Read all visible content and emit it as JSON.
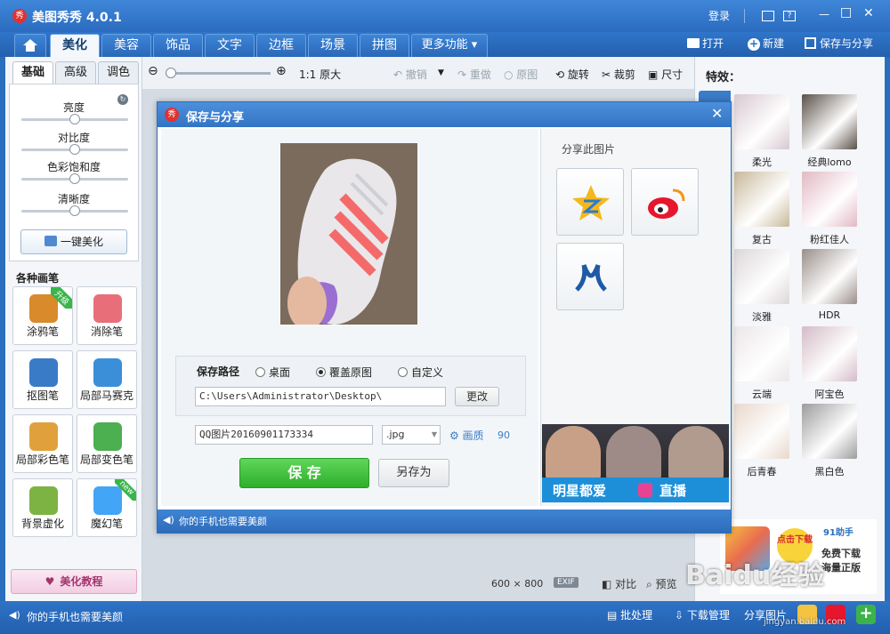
{
  "app": {
    "title": "美图秀秀 4.0.1",
    "logo_glyph": "秀"
  },
  "window_controls": {
    "login": "登录",
    "help": "?",
    "minimize": "—",
    "maximize": "□",
    "close": "✕"
  },
  "menu_tabs": [
    "美化",
    "美容",
    "饰品",
    "文字",
    "边框",
    "场景",
    "拼图",
    "更多功能 ▾"
  ],
  "menu_actions": {
    "open": "打开",
    "new": "新建",
    "save_share": "保存与分享"
  },
  "toolbar": {
    "original_size": "1:1 原大",
    "undo": "撤销",
    "redo": "重做",
    "original": "原图",
    "rotate": "旋转",
    "crop": "裁剪",
    "resize": "尺寸"
  },
  "left_panel": {
    "tabs": [
      "基础",
      "高级",
      "调色"
    ],
    "sliders": [
      {
        "label": "亮度",
        "value": 0.5
      },
      {
        "label": "对比度",
        "value": 0.5
      },
      {
        "label": "色彩饱和度",
        "value": 0.5
      },
      {
        "label": "清晰度",
        "value": 0.5
      }
    ],
    "one_click": "一键美化",
    "brushes_title": "各种画笔",
    "brushes": [
      {
        "label": "涂鸦笔",
        "badge": "升级",
        "color": "#d98a2b"
      },
      {
        "label": "消除笔",
        "badge": "",
        "color": "#e86f7a"
      },
      {
        "label": "抠图笔",
        "badge": "",
        "color": "#3a7bc8"
      },
      {
        "label": "局部马赛克",
        "badge": "",
        "color": "#3b8fd9"
      },
      {
        "label": "局部彩色笔",
        "badge": "",
        "color": "#e0a13c"
      },
      {
        "label": "局部变色笔",
        "badge": "",
        "color": "#4caf50"
      },
      {
        "label": "背景虚化",
        "badge": "",
        "color": "#7cb342"
      },
      {
        "label": "魔幻笔",
        "badge": "new",
        "color": "#42a5f5"
      }
    ],
    "tutorial": "美化教程"
  },
  "right_panel": {
    "title": "特效：",
    "effects": [
      {
        "label": "柔光",
        "color": "#d8c8d0"
      },
      {
        "label": "经典lomo",
        "color": "#5a5048"
      },
      {
        "label": "复古",
        "color": "#c8b89a"
      },
      {
        "label": "粉红佳人",
        "color": "#e2b8c4"
      },
      {
        "label": "淡雅",
        "color": "#ddd6d8"
      },
      {
        "label": "HDR",
        "color": "#9a8e8a"
      },
      {
        "label": "云端",
        "color": "#ece6e8"
      },
      {
        "label": "阿宝色",
        "color": "#d4bcc6"
      },
      {
        "label": "后青春",
        "color": "#e8d8cc"
      },
      {
        "label": "黑白色",
        "color": "#9c9c9c"
      }
    ],
    "ad": {
      "brand": "91助手",
      "cta": "点击下载",
      "line1": "免费下载",
      "line2": "海量正版"
    }
  },
  "canvas_footer": {
    "dimensions": "600 × 800",
    "exif": "EXIF",
    "compare": "对比",
    "preview": "预览"
  },
  "dialog": {
    "title": "保存与分享",
    "share_title": "分享此图片",
    "save_path_label": "保存路径",
    "path_options": [
      {
        "label": "桌面",
        "selected": false
      },
      {
        "label": "覆盖原图",
        "selected": true
      },
      {
        "label": "自定义",
        "selected": false
      }
    ],
    "path": "C:\\Users\\Administrator\\Desktop\\",
    "change": "更改",
    "filename": "QQ图片20160901173334",
    "ext": ".jpg",
    "quality_label": "画质",
    "quality": "90",
    "save": "保 存",
    "save_as": "另存为",
    "banner_left": "明星都爱",
    "banner_right": "直播",
    "footer": "你的手机也需要美颜"
  },
  "status": {
    "message": "你的手机也需要美颜",
    "batch": "批处理",
    "download_mgr": "下载管理",
    "share_pic": "分享图片",
    "watermark": "Baidu经验",
    "watermark_url": "jingyan.baidu.com"
  }
}
